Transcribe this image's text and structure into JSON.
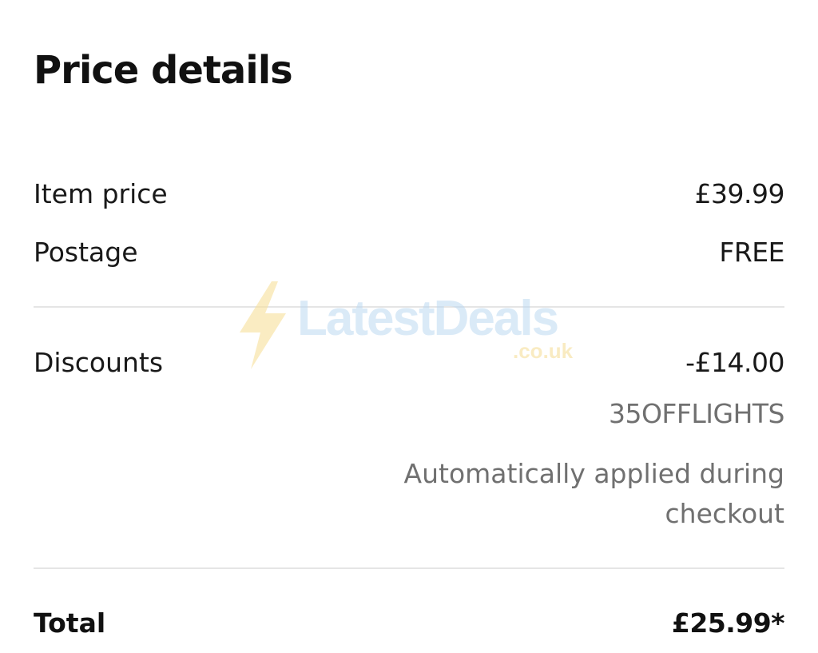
{
  "header": {
    "title": "Price details"
  },
  "rows": {
    "item_price": {
      "label": "Item price",
      "value": "£39.99"
    },
    "postage": {
      "label": "Postage",
      "value": "FREE"
    },
    "discounts": {
      "label": "Discounts",
      "value": "-£14.00",
      "code": "35OFFLIGHTS",
      "note": "Automatically applied during checkout"
    },
    "total": {
      "label": "Total",
      "value": "£25.99*"
    }
  },
  "watermark": {
    "text": "LatestDeals",
    "sub": ".co.uk",
    "icon": "lightning-bolt-icon"
  },
  "colors": {
    "text_primary": "#191919",
    "text_secondary": "#707070",
    "divider": "#e5e5e5",
    "watermark_blue": "#bcd9f2",
    "watermark_yellow": "#f6df9a"
  }
}
